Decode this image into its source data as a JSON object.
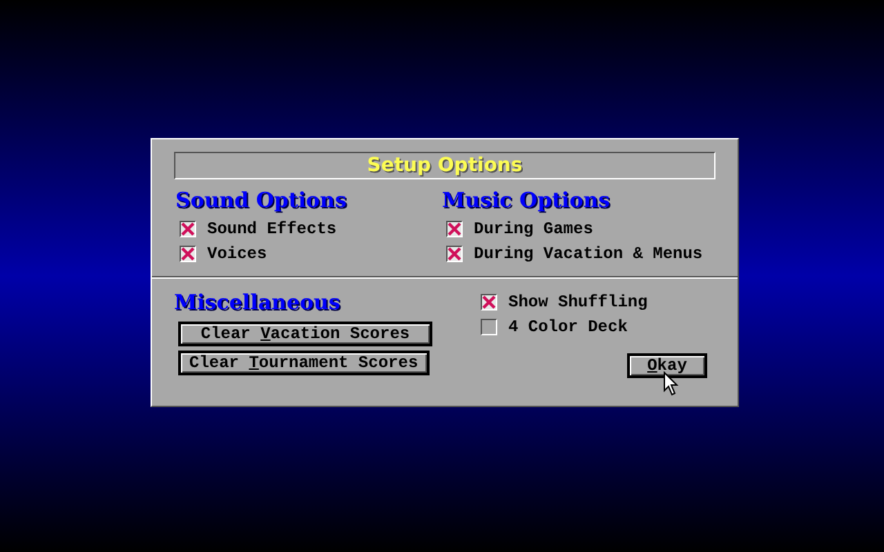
{
  "dialog": {
    "title": "Setup Options",
    "sections": [
      {
        "heading": "Sound Options",
        "options": [
          {
            "label": "Sound Effects",
            "checked": true
          },
          {
            "label": "Voices",
            "checked": true
          }
        ]
      },
      {
        "heading": "Music Options",
        "options": [
          {
            "label": "During Games",
            "checked": true
          },
          {
            "label": "During Vacation & Menus",
            "checked": true
          }
        ]
      }
    ],
    "misc": {
      "heading": "Miscellaneous",
      "buttons": [
        {
          "before": "Clear ",
          "key": "V",
          "after": "acation Scores"
        },
        {
          "before": "Clear ",
          "key": "T",
          "after": "ournament Scores"
        }
      ],
      "options": [
        {
          "label": "Show Shuffling",
          "checked": true
        },
        {
          "label": "4 Color Deck",
          "checked": false
        }
      ],
      "ok": {
        "key": "O",
        "after": "kay"
      }
    }
  }
}
